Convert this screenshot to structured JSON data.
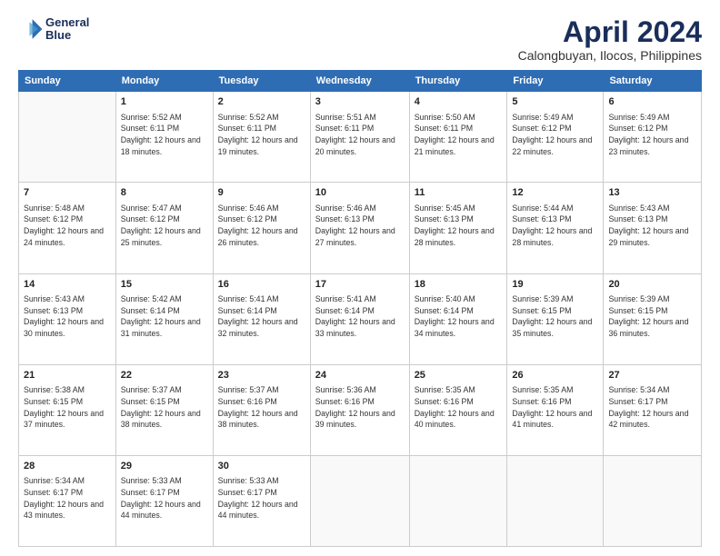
{
  "logo": {
    "line1": "General",
    "line2": "Blue"
  },
  "title": "April 2024",
  "location": "Calongbuyan, Ilocos, Philippines",
  "weekdays": [
    "Sunday",
    "Monday",
    "Tuesday",
    "Wednesday",
    "Thursday",
    "Friday",
    "Saturday"
  ],
  "weeks": [
    [
      {
        "day": "",
        "sunrise": "",
        "sunset": "",
        "daylight": ""
      },
      {
        "day": "1",
        "sunrise": "Sunrise: 5:52 AM",
        "sunset": "Sunset: 6:11 PM",
        "daylight": "Daylight: 12 hours and 18 minutes."
      },
      {
        "day": "2",
        "sunrise": "Sunrise: 5:52 AM",
        "sunset": "Sunset: 6:11 PM",
        "daylight": "Daylight: 12 hours and 19 minutes."
      },
      {
        "day": "3",
        "sunrise": "Sunrise: 5:51 AM",
        "sunset": "Sunset: 6:11 PM",
        "daylight": "Daylight: 12 hours and 20 minutes."
      },
      {
        "day": "4",
        "sunrise": "Sunrise: 5:50 AM",
        "sunset": "Sunset: 6:11 PM",
        "daylight": "Daylight: 12 hours and 21 minutes."
      },
      {
        "day": "5",
        "sunrise": "Sunrise: 5:49 AM",
        "sunset": "Sunset: 6:12 PM",
        "daylight": "Daylight: 12 hours and 22 minutes."
      },
      {
        "day": "6",
        "sunrise": "Sunrise: 5:49 AM",
        "sunset": "Sunset: 6:12 PM",
        "daylight": "Daylight: 12 hours and 23 minutes."
      }
    ],
    [
      {
        "day": "7",
        "sunrise": "Sunrise: 5:48 AM",
        "sunset": "Sunset: 6:12 PM",
        "daylight": "Daylight: 12 hours and 24 minutes."
      },
      {
        "day": "8",
        "sunrise": "Sunrise: 5:47 AM",
        "sunset": "Sunset: 6:12 PM",
        "daylight": "Daylight: 12 hours and 25 minutes."
      },
      {
        "day": "9",
        "sunrise": "Sunrise: 5:46 AM",
        "sunset": "Sunset: 6:12 PM",
        "daylight": "Daylight: 12 hours and 26 minutes."
      },
      {
        "day": "10",
        "sunrise": "Sunrise: 5:46 AM",
        "sunset": "Sunset: 6:13 PM",
        "daylight": "Daylight: 12 hours and 27 minutes."
      },
      {
        "day": "11",
        "sunrise": "Sunrise: 5:45 AM",
        "sunset": "Sunset: 6:13 PM",
        "daylight": "Daylight: 12 hours and 28 minutes."
      },
      {
        "day": "12",
        "sunrise": "Sunrise: 5:44 AM",
        "sunset": "Sunset: 6:13 PM",
        "daylight": "Daylight: 12 hours and 28 minutes."
      },
      {
        "day": "13",
        "sunrise": "Sunrise: 5:43 AM",
        "sunset": "Sunset: 6:13 PM",
        "daylight": "Daylight: 12 hours and 29 minutes."
      }
    ],
    [
      {
        "day": "14",
        "sunrise": "Sunrise: 5:43 AM",
        "sunset": "Sunset: 6:13 PM",
        "daylight": "Daylight: 12 hours and 30 minutes."
      },
      {
        "day": "15",
        "sunrise": "Sunrise: 5:42 AM",
        "sunset": "Sunset: 6:14 PM",
        "daylight": "Daylight: 12 hours and 31 minutes."
      },
      {
        "day": "16",
        "sunrise": "Sunrise: 5:41 AM",
        "sunset": "Sunset: 6:14 PM",
        "daylight": "Daylight: 12 hours and 32 minutes."
      },
      {
        "day": "17",
        "sunrise": "Sunrise: 5:41 AM",
        "sunset": "Sunset: 6:14 PM",
        "daylight": "Daylight: 12 hours and 33 minutes."
      },
      {
        "day": "18",
        "sunrise": "Sunrise: 5:40 AM",
        "sunset": "Sunset: 6:14 PM",
        "daylight": "Daylight: 12 hours and 34 minutes."
      },
      {
        "day": "19",
        "sunrise": "Sunrise: 5:39 AM",
        "sunset": "Sunset: 6:15 PM",
        "daylight": "Daylight: 12 hours and 35 minutes."
      },
      {
        "day": "20",
        "sunrise": "Sunrise: 5:39 AM",
        "sunset": "Sunset: 6:15 PM",
        "daylight": "Daylight: 12 hours and 36 minutes."
      }
    ],
    [
      {
        "day": "21",
        "sunrise": "Sunrise: 5:38 AM",
        "sunset": "Sunset: 6:15 PM",
        "daylight": "Daylight: 12 hours and 37 minutes."
      },
      {
        "day": "22",
        "sunrise": "Sunrise: 5:37 AM",
        "sunset": "Sunset: 6:15 PM",
        "daylight": "Daylight: 12 hours and 38 minutes."
      },
      {
        "day": "23",
        "sunrise": "Sunrise: 5:37 AM",
        "sunset": "Sunset: 6:16 PM",
        "daylight": "Daylight: 12 hours and 38 minutes."
      },
      {
        "day": "24",
        "sunrise": "Sunrise: 5:36 AM",
        "sunset": "Sunset: 6:16 PM",
        "daylight": "Daylight: 12 hours and 39 minutes."
      },
      {
        "day": "25",
        "sunrise": "Sunrise: 5:35 AM",
        "sunset": "Sunset: 6:16 PM",
        "daylight": "Daylight: 12 hours and 40 minutes."
      },
      {
        "day": "26",
        "sunrise": "Sunrise: 5:35 AM",
        "sunset": "Sunset: 6:16 PM",
        "daylight": "Daylight: 12 hours and 41 minutes."
      },
      {
        "day": "27",
        "sunrise": "Sunrise: 5:34 AM",
        "sunset": "Sunset: 6:17 PM",
        "daylight": "Daylight: 12 hours and 42 minutes."
      }
    ],
    [
      {
        "day": "28",
        "sunrise": "Sunrise: 5:34 AM",
        "sunset": "Sunset: 6:17 PM",
        "daylight": "Daylight: 12 hours and 43 minutes."
      },
      {
        "day": "29",
        "sunrise": "Sunrise: 5:33 AM",
        "sunset": "Sunset: 6:17 PM",
        "daylight": "Daylight: 12 hours and 44 minutes."
      },
      {
        "day": "30",
        "sunrise": "Sunrise: 5:33 AM",
        "sunset": "Sunset: 6:17 PM",
        "daylight": "Daylight: 12 hours and 44 minutes."
      },
      {
        "day": "",
        "sunrise": "",
        "sunset": "",
        "daylight": ""
      },
      {
        "day": "",
        "sunrise": "",
        "sunset": "",
        "daylight": ""
      },
      {
        "day": "",
        "sunrise": "",
        "sunset": "",
        "daylight": ""
      },
      {
        "day": "",
        "sunrise": "",
        "sunset": "",
        "daylight": ""
      }
    ]
  ]
}
